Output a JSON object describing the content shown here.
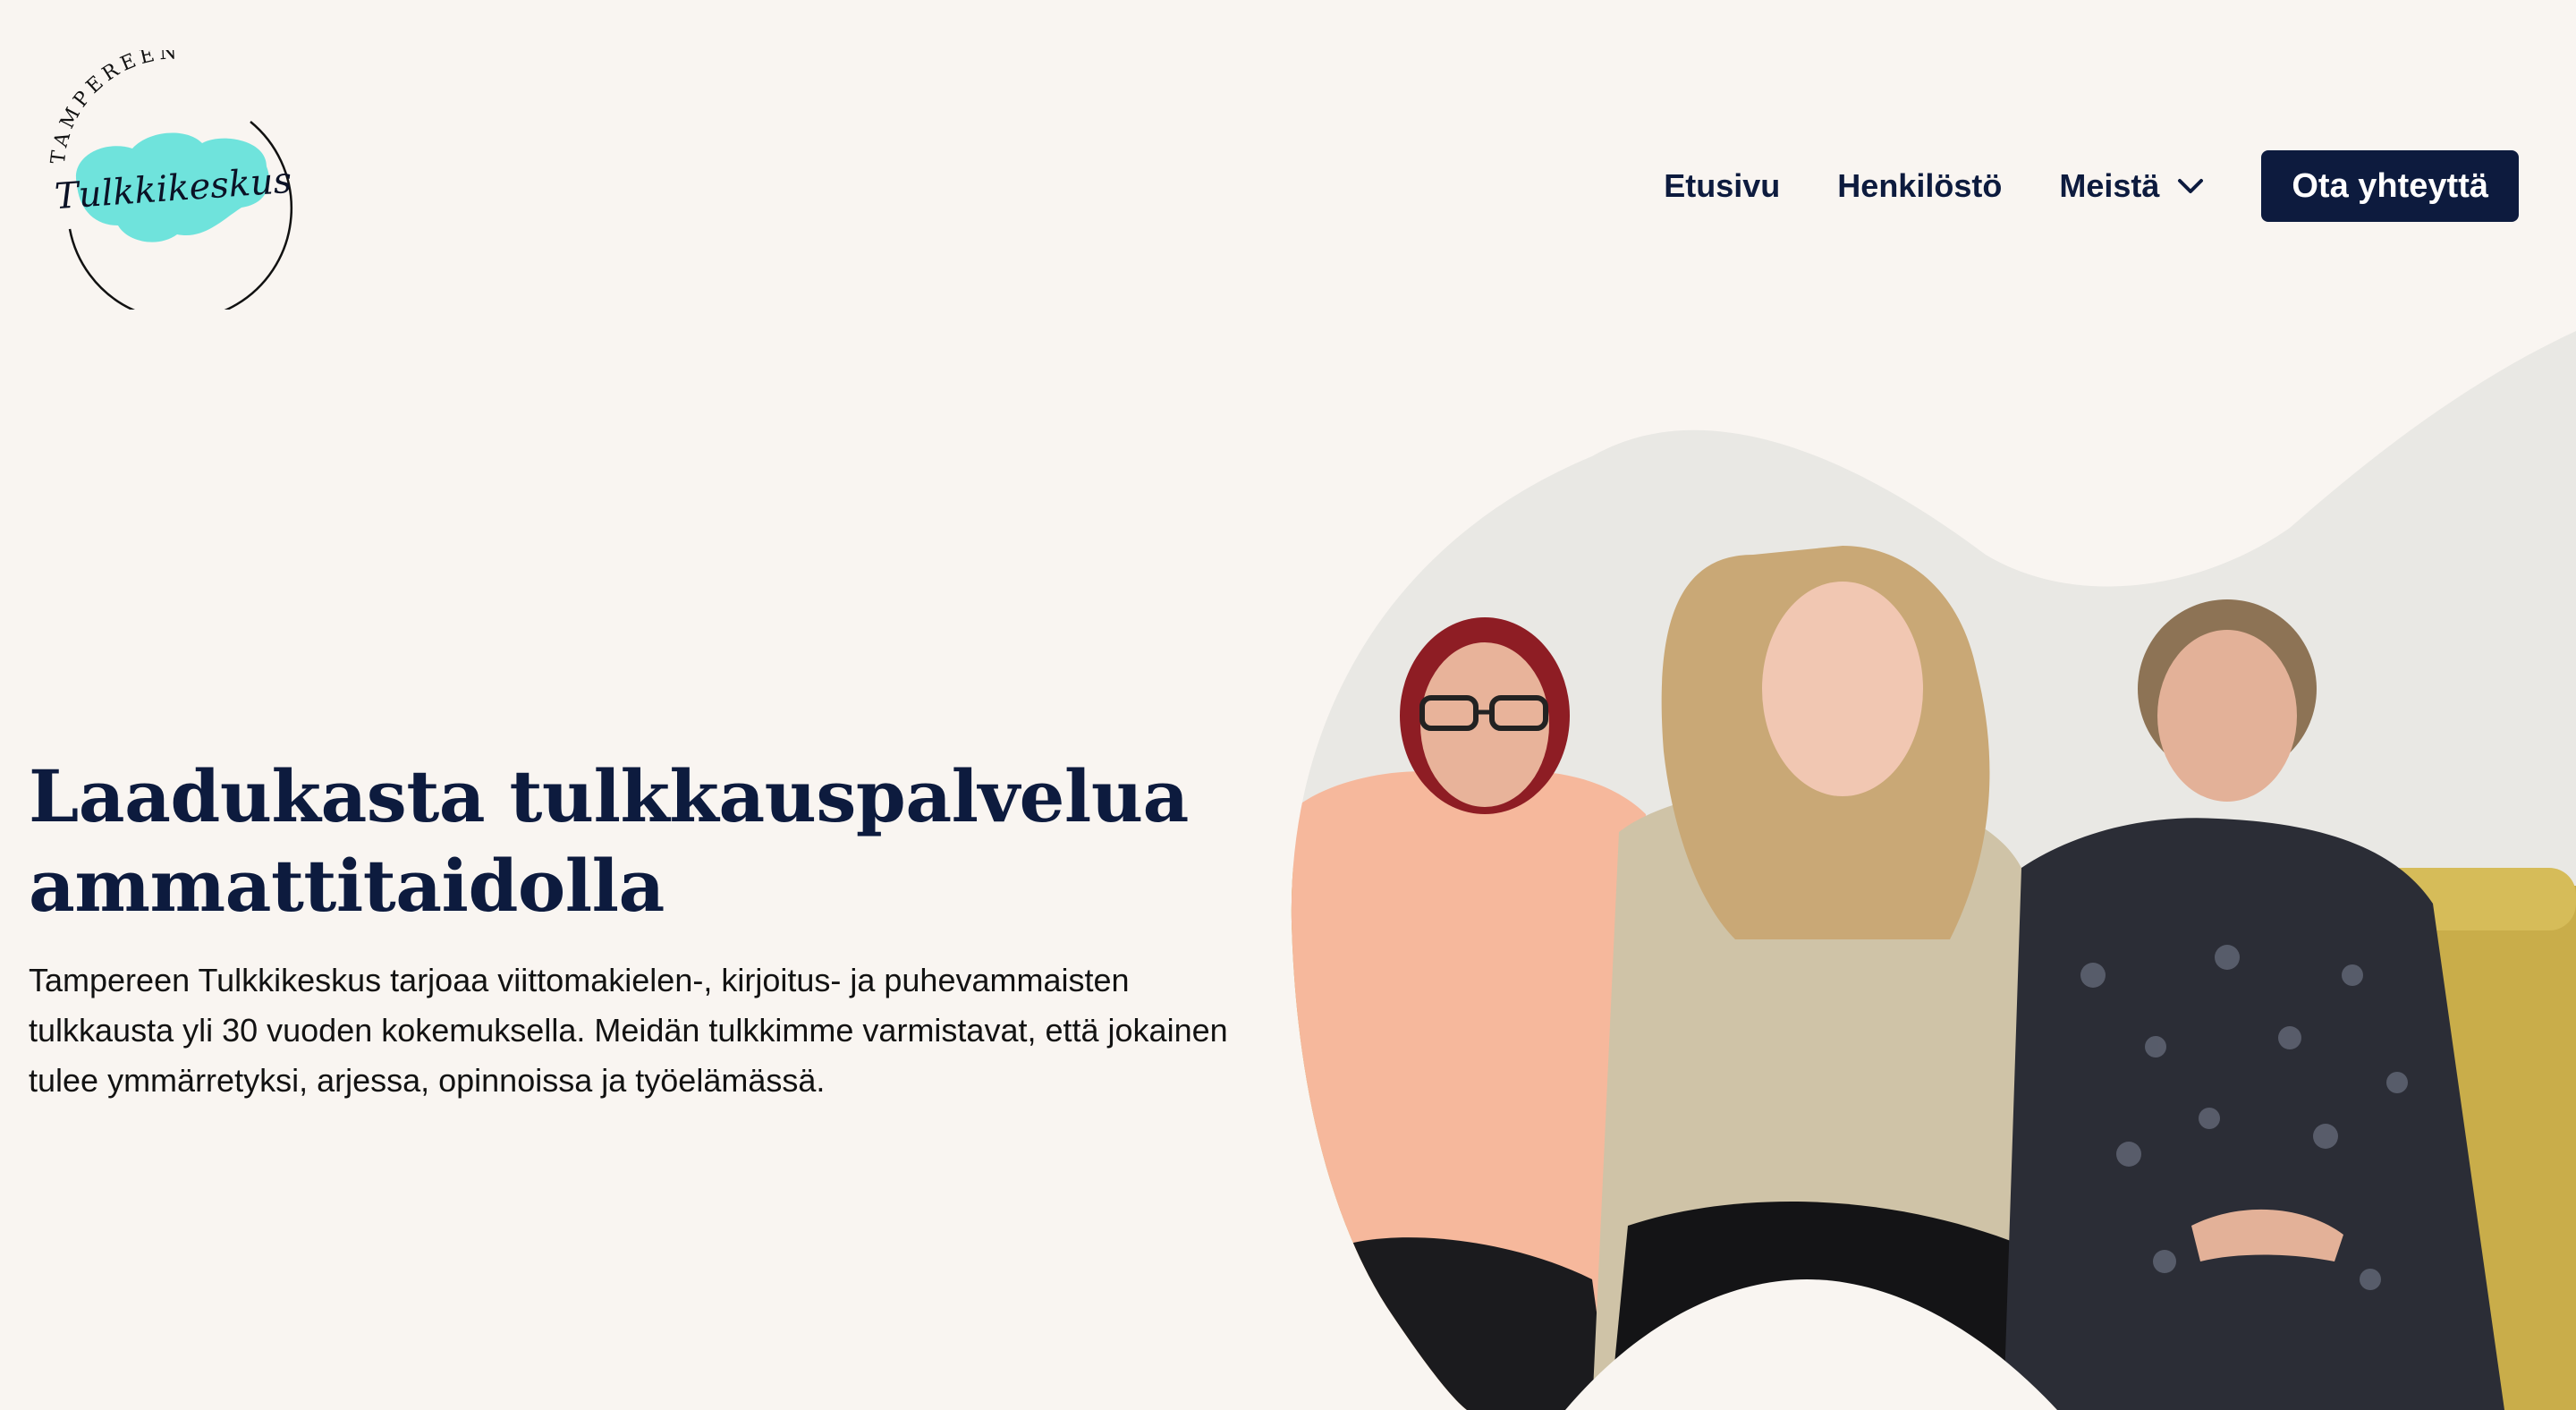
{
  "logo": {
    "arc_text": "TAMPEREEN",
    "wordmark": "Tulkkikeskus"
  },
  "nav": {
    "items": [
      {
        "label": "Etusivu"
      },
      {
        "label": "Henkilöstö"
      },
      {
        "label": "Meistä",
        "icon": "chevron-down-icon"
      }
    ],
    "cta_label": "Ota yhteyttä"
  },
  "hero": {
    "title_line1": "Laadukasta tulkkauspalvelua",
    "title_line2": "ammattitaidolla",
    "lead": "Tampereen Tulkkikeskus tarjoaa viittomakielen-, kirjoitus- ja puhevammaisten tulkkausta yli 30 vuoden kokemuksella. Meidän tulkkimme varmistavat, että jokainen tulee ymmärretyksi, arjessa, opinnoissa ja työelämässä."
  },
  "colors": {
    "background": "#f9f5f1",
    "navy": "#0d1b3e",
    "logo_blob": "#6fe3dc",
    "photo_wall": "#e9e8e4",
    "sofa": "#c9ad4a"
  }
}
